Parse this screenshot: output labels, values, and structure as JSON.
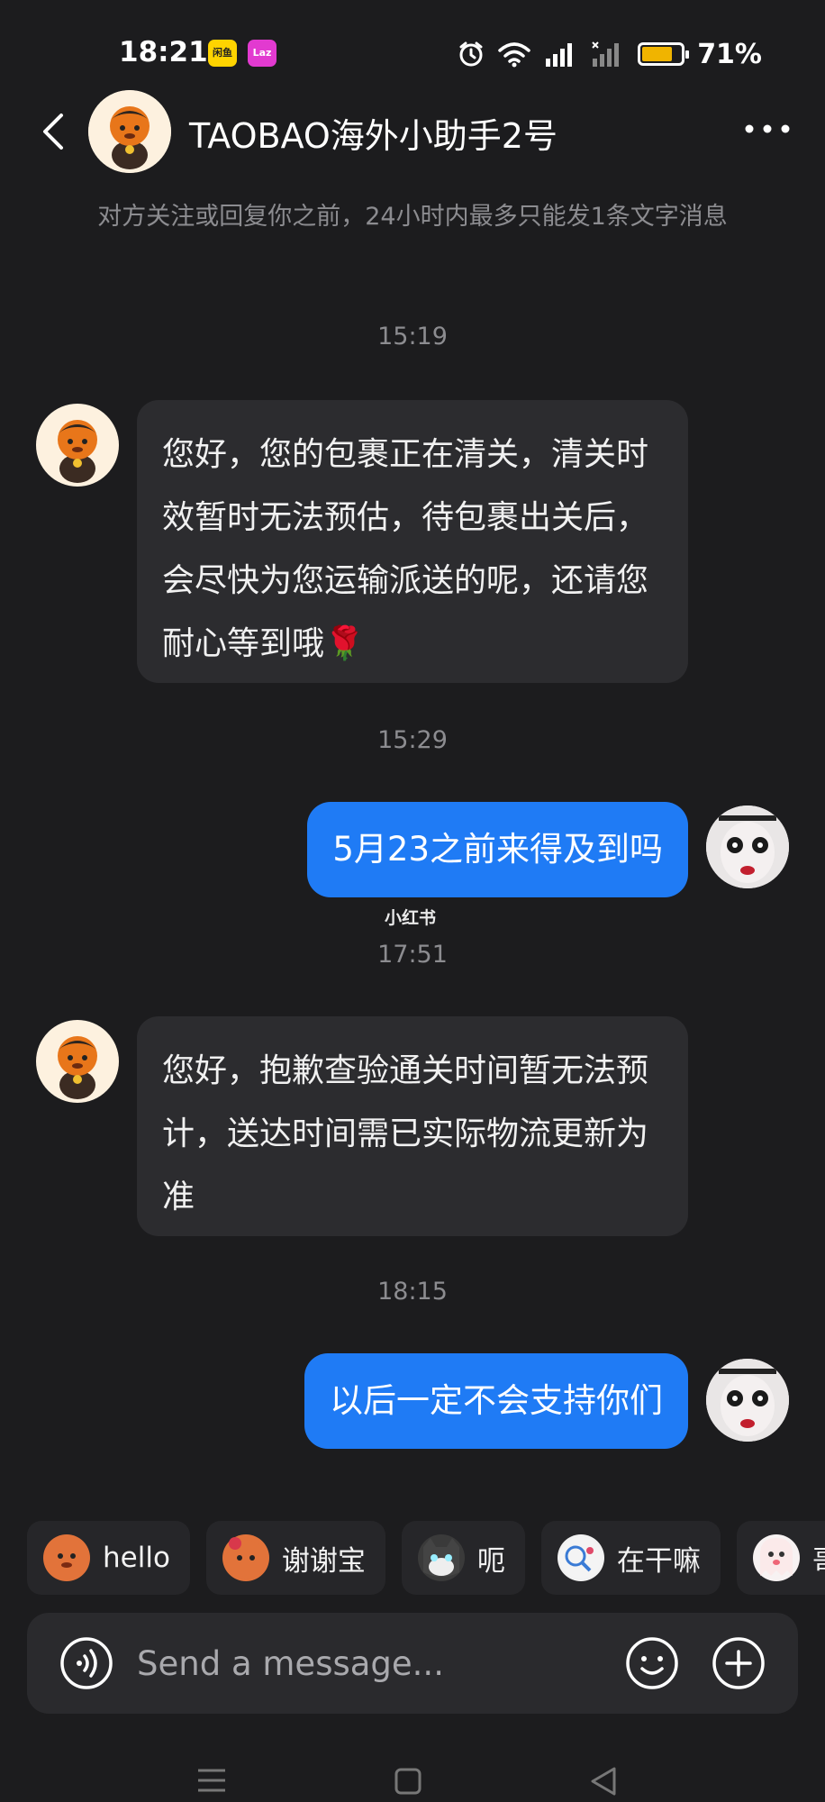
{
  "status_bar": {
    "time": "18:21",
    "app1": "闲鱼",
    "app2": "Laz",
    "battery_percent": "71%",
    "battery_level": 0.71
  },
  "header": {
    "title": "TAOBAO海外小助手2号"
  },
  "notice": "对方关注或回复你之前，24小时内最多只能发1条文字消息",
  "messages": [
    {
      "time": "15:19",
      "direction": "incoming",
      "text": "您好，您的包裹正在清关，清关时效暂时无法预估，待包裹出关后，会尽快为您运输派送的呢，还请您耐心等到哦🌹"
    },
    {
      "time": "15:29",
      "direction": "outgoing",
      "text": "5月23之前来得及到吗"
    },
    {
      "time": "17:51",
      "direction": "incoming",
      "text": "您好，抱歉查验通关时间暂无法预计，送达时间需已实际物流更新为准"
    },
    {
      "time": "18:15",
      "direction": "outgoing",
      "text": "以后一定不会支持你们"
    }
  ],
  "watermark": "小红书",
  "quick_replies": [
    {
      "label": "hello",
      "icon": "monkey-emoji-icon"
    },
    {
      "label": "谢谢宝",
      "icon": "monkey-flower-emoji-icon"
    },
    {
      "label": "呃",
      "icon": "cat-emoji-icon"
    },
    {
      "label": "在干嘛",
      "icon": "bird-search-emoji-icon"
    },
    {
      "label": "哥",
      "icon": "ghost-emoji-icon"
    }
  ],
  "input": {
    "placeholder": "Send a message..."
  },
  "colors": {
    "background": "#1c1c1e",
    "outgoing_bubble": "#1f7bf5",
    "incoming_bubble": "#2c2c2f"
  }
}
